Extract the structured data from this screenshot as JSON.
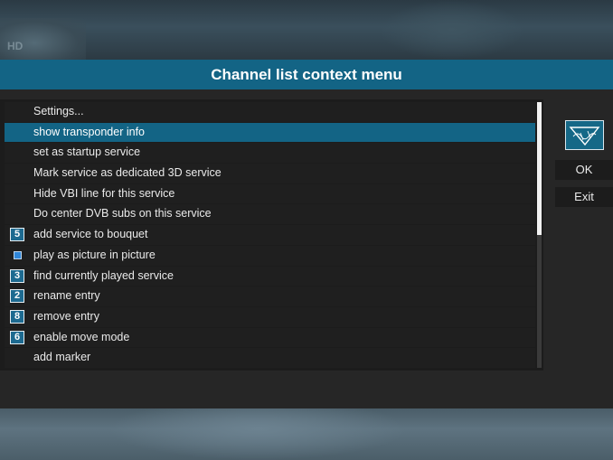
{
  "dialog": {
    "title": "Channel list context menu"
  },
  "background": {
    "hd_mark": "HD"
  },
  "menu": {
    "items": [
      {
        "label": "Settings...",
        "key": "",
        "selected": false
      },
      {
        "label": "show transponder info",
        "key": "",
        "selected": true
      },
      {
        "label": "set as startup service",
        "key": "",
        "selected": false
      },
      {
        "label": "Mark service as dedicated 3D service",
        "key": "",
        "selected": false
      },
      {
        "label": "Hide VBI line for this service",
        "key": "",
        "selected": false
      },
      {
        "label": "Do center DVB subs on this service",
        "key": "",
        "selected": false
      },
      {
        "label": "add service to bouquet",
        "key": "5",
        "selected": false
      },
      {
        "label": "play as picture in picture",
        "key": "pip-icon",
        "selected": false
      },
      {
        "label": "find currently played service",
        "key": "3",
        "selected": false
      },
      {
        "label": "rename entry",
        "key": "2",
        "selected": false
      },
      {
        "label": "remove entry",
        "key": "8",
        "selected": false
      },
      {
        "label": "enable move mode",
        "key": "6",
        "selected": false
      },
      {
        "label": "add marker",
        "key": "",
        "selected": false
      }
    ],
    "scroll_fraction_visible": 0.5
  },
  "side": {
    "ok_label": "OK",
    "exit_label": "Exit"
  },
  "colors": {
    "accent": "#136485",
    "panel": "#262626",
    "list_bg": "#1c1c1c"
  }
}
